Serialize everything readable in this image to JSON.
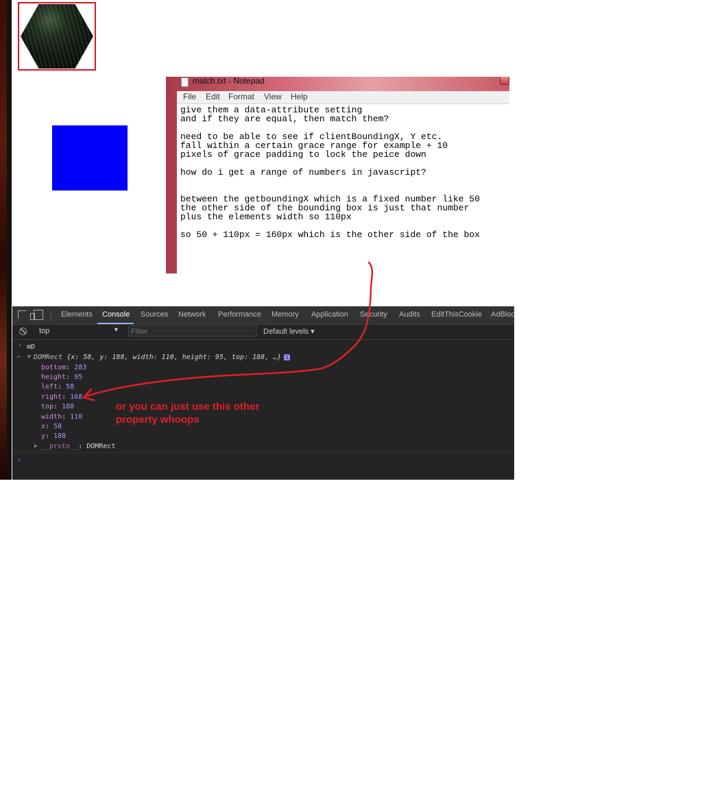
{
  "notepad": {
    "title": "match.txt - Notepad",
    "menu": [
      "File",
      "Edit",
      "Format",
      "View",
      "Help"
    ],
    "lines": [
      "give them a data-attribute setting",
      "and if they are equal, then match them?",
      "",
      "need to be able to see if clientBoundingX, Y etc.",
      "fall within a certain grace range for example + 10",
      "pixels of grace padding to lock the peice down",
      "",
      "how do i get a range of numbers in javascript?",
      "",
      "",
      "between the getboundingX which is a fixed number like 50",
      "the other side of the bounding box is just that number",
      "plus the elements width so 110px",
      "",
      "so 50 + 110px = 160px which is the other side of the box"
    ]
  },
  "devtools": {
    "tabs": [
      "Elements",
      "Console",
      "Sources",
      "Network",
      "Performance",
      "Memory",
      "Application",
      "Security",
      "Audits",
      "EditThisCookie",
      "AdBlock"
    ],
    "active_tab": "Console",
    "context": "top",
    "filter_placeholder": "Filter",
    "levels": "Default levels",
    "console": {
      "input": "mD",
      "summary_type": "DOMRect",
      "summary": "{x: 58, y: 188, width: 110, height: 95, top: 188, …}",
      "info_badge": "i",
      "properties": [
        {
          "key": "bottom",
          "value": "283"
        },
        {
          "key": "height",
          "value": "95"
        },
        {
          "key": "left",
          "value": "58"
        },
        {
          "key": "right",
          "value": "168"
        },
        {
          "key": "top",
          "value": "188"
        },
        {
          "key": "width",
          "value": "110"
        },
        {
          "key": "x",
          "value": "58"
        },
        {
          "key": "y",
          "value": "188"
        }
      ],
      "proto_key": "__proto__",
      "proto_value": "DOMRect",
      "prompt": "›"
    }
  },
  "annotation": {
    "text": "or you can just use this other\nproperty whoops",
    "color": "#e0202a"
  },
  "colors": {
    "blue_box": "#0000ff",
    "hexagon_border": "#e2131f",
    "devtools_bg": "#242424"
  }
}
